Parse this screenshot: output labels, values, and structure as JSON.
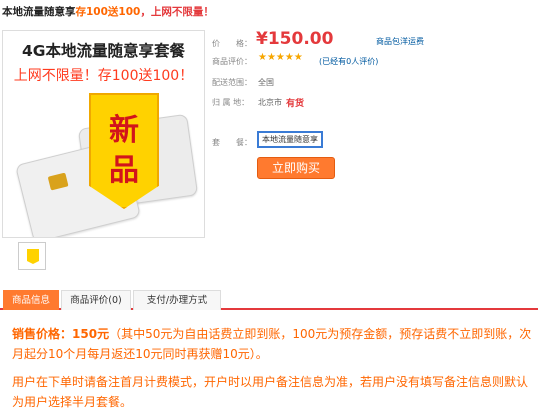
{
  "title": {
    "part1": "本地流量随意享",
    "part2": "存100送100",
    "part3": "，上网不限量！"
  },
  "product_image": {
    "title": "4G本地流量随意享套餐",
    "subtitle": "上网不限量！存100送100！",
    "badge_char1": "新",
    "badge_char2": "品"
  },
  "info": {
    "price_label": "价　　格：",
    "price_value": "¥150.00",
    "shipping_note": "商品包洋运费",
    "rating_label": "商品评价：",
    "stars": "★★★★★",
    "rating_count": "(已经有0人评价)",
    "delivery_label": "配送范围：",
    "delivery_value": "全国",
    "location_label": "归 属 地：",
    "location_value": "北京市",
    "stock_value": "有货",
    "plan_label": "套　　餐：",
    "plan_option": "本地流量随意享"
  },
  "buy_button": "立即购买",
  "tabs": [
    "商品信息",
    "商品评价(0)",
    "支付/办理方式"
  ],
  "description": {
    "price_label": "销售价格：",
    "price_value": "150元",
    "price_detail": "（其中50元为自由话费立即到账，100元为预存金额，预存话费不立即到账，次月起分10个月每月返还10元同时再获赠10元）。",
    "note": "用户在下单时请备注首月计费模式，开户时以用户备注信息为准，若用户没有填写备注信息则默认为用户选择半月套餐。"
  },
  "colors": {
    "accent": "#ff7a2f",
    "price": "#e4393c",
    "link": "#005aa0",
    "badge": "#ffd200"
  }
}
